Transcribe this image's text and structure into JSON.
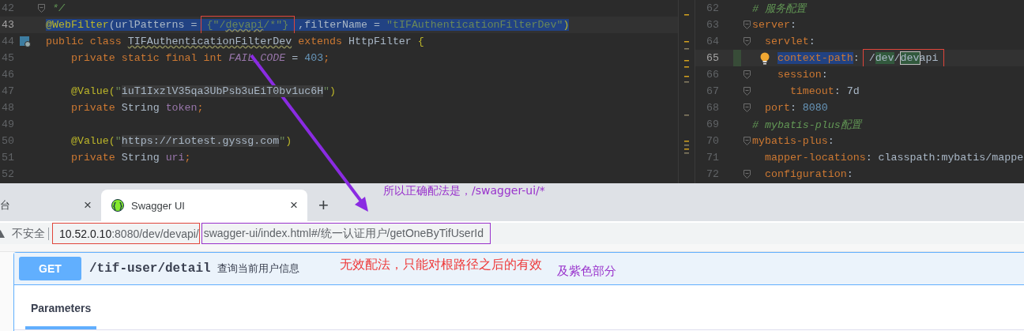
{
  "code_editor": {
    "lines": [
      {
        "number": "42",
        "fold": true,
        "current": false,
        "selected": false,
        "tokens": [
          {
            "text": " */",
            "kind": "doc"
          }
        ]
      },
      {
        "number": "43",
        "fold": false,
        "current": true,
        "selected": true,
        "tokens": [
          {
            "text": "@WebFilter",
            "kind": "annotation"
          },
          {
            "text": "(urlPatterns = ",
            "kind": "plain"
          },
          {
            "kind": "boxed",
            "parts": [
              {
                "text": "{\"/",
                "kind": "string"
              },
              {
                "text": "devapi",
                "kind": "string",
                "squiggle": true
              },
              {
                "text": "/*\"}",
                "kind": "string"
              }
            ]
          },
          {
            "text": " ,filterName = ",
            "kind": "plain"
          },
          {
            "text": "\"tIFAuthenticationFilterDev\"",
            "kind": "string"
          },
          {
            "text": ")",
            "kind": "annotation"
          }
        ]
      },
      {
        "number": "44",
        "fold": false,
        "current": false,
        "selected": false,
        "kind": "declaration",
        "tokens": [
          {
            "text": "public class ",
            "kind": "keyword"
          },
          {
            "text": "TIFAuthenticationFilterDev",
            "kind": "plain",
            "squiggle": true
          },
          {
            "text": " extends ",
            "kind": "keyword"
          },
          {
            "text": "HttpFilter ",
            "kind": "plain"
          },
          {
            "text": "{",
            "kind": "annotation"
          }
        ]
      },
      {
        "number": "45",
        "fold": false,
        "current": false,
        "selected": false,
        "tokens": [
          {
            "text": "    private static final int ",
            "kind": "keyword"
          },
          {
            "text": "FAIL_CODE",
            "kind": "constant"
          },
          {
            "text": " = ",
            "kind": "plain"
          },
          {
            "text": "403",
            "kind": "number"
          },
          {
            "text": ";",
            "kind": "keyword"
          }
        ]
      },
      {
        "number": "46",
        "fold": false,
        "current": false,
        "selected": false
      },
      {
        "number": "47",
        "fold": false,
        "current": false,
        "selected": false,
        "tokens": [
          {
            "text": "    @Value(",
            "kind": "annotation"
          },
          {
            "text": "\"",
            "kind": "string"
          },
          {
            "text": "iuT1IxzlV35qa3UbPsb3uEiT0bv1uc6H",
            "kind": "plain",
            "literal": true
          },
          {
            "text": "\"",
            "kind": "string"
          },
          {
            "text": ")",
            "kind": "annotation"
          }
        ]
      },
      {
        "number": "48",
        "fold": false,
        "current": false,
        "selected": false,
        "tokens": [
          {
            "text": "    private ",
            "kind": "keyword"
          },
          {
            "text": "String ",
            "kind": "plain"
          },
          {
            "text": "token",
            "kind": "field"
          },
          {
            "text": ";",
            "kind": "keyword"
          }
        ]
      },
      {
        "number": "49",
        "fold": false,
        "current": false,
        "selected": false
      },
      {
        "number": "50",
        "fold": false,
        "current": false,
        "selected": false,
        "tokens": [
          {
            "text": "    @Value(",
            "kind": "annotation"
          },
          {
            "text": "\"",
            "kind": "string"
          },
          {
            "text": "https://riotest.gyssg.com",
            "kind": "plain",
            "literal": true
          },
          {
            "text": "\"",
            "kind": "string"
          },
          {
            "text": ")",
            "kind": "annotation"
          }
        ]
      },
      {
        "number": "51",
        "fold": false,
        "current": false,
        "selected": false,
        "tokens": [
          {
            "text": "    private ",
            "kind": "keyword"
          },
          {
            "text": "String ",
            "kind": "plain"
          },
          {
            "text": "uri",
            "kind": "field"
          },
          {
            "text": ";",
            "kind": "keyword"
          }
        ]
      },
      {
        "number": "52",
        "fold": false,
        "current": false,
        "selected": false
      }
    ]
  },
  "config_editor": {
    "lines": [
      {
        "number": "62",
        "fold": false,
        "current": false,
        "changed": false,
        "tokens": [
          {
            "text": "# 服务配置",
            "kind": "comment"
          }
        ]
      },
      {
        "number": "63",
        "fold": true,
        "current": false,
        "changed": false,
        "tokens": [
          {
            "text": "server",
            "kind": "keyword"
          },
          {
            "text": ":",
            "kind": "plain"
          }
        ]
      },
      {
        "number": "64",
        "fold": true,
        "current": false,
        "changed": false,
        "tokens": [
          {
            "text": "  servlet",
            "kind": "keyword"
          },
          {
            "text": ":",
            "kind": "plain"
          }
        ]
      },
      {
        "number": "65",
        "fold": false,
        "current": true,
        "changed": true,
        "kind": "intention",
        "tokens": [
          {
            "text": "    context-path",
            "kind": "keyword",
            "selected": true
          },
          {
            "text": ": ",
            "kind": "plain"
          },
          {
            "kind": "boxed",
            "parts": [
              {
                "text": "/",
                "kind": "plain"
              },
              {
                "text": "dev",
                "kind": "plain",
                "match": true
              },
              {
                "text": "/",
                "kind": "plain"
              },
              {
                "text": "dev",
                "kind": "plain",
                "current_match": true
              },
              {
                "text": "api",
                "kind": "plain"
              }
            ]
          }
        ]
      },
      {
        "number": "66",
        "fold": true,
        "current": false,
        "changed": false,
        "tokens": [
          {
            "text": "    session",
            "kind": "keyword"
          },
          {
            "text": ":",
            "kind": "plain"
          }
        ]
      },
      {
        "number": "67",
        "fold": true,
        "current": false,
        "changed": false,
        "tokens": [
          {
            "text": "      timeout",
            "kind": "keyword"
          },
          {
            "text": ": ",
            "kind": "plain"
          },
          {
            "text": "7d",
            "kind": "plain"
          }
        ]
      },
      {
        "number": "68",
        "fold": true,
        "current": false,
        "changed": false,
        "tokens": [
          {
            "text": "  port",
            "kind": "keyword"
          },
          {
            "text": ": ",
            "kind": "plain"
          },
          {
            "text": "8080",
            "kind": "number"
          }
        ]
      },
      {
        "number": "69",
        "fold": false,
        "current": false,
        "changed": false,
        "tokens": [
          {
            "text": "# mybatis-plus配置",
            "kind": "comment"
          }
        ]
      },
      {
        "number": "70",
        "fold": true,
        "current": false,
        "changed": false,
        "tokens": [
          {
            "text": "mybatis-plus",
            "kind": "keyword"
          },
          {
            "text": ":",
            "kind": "plain"
          }
        ]
      },
      {
        "number": "71",
        "fold": false,
        "current": false,
        "changed": false,
        "tokens": [
          {
            "text": "  mapper-locations",
            "kind": "keyword"
          },
          {
            "text": ": ",
            "kind": "plain"
          },
          {
            "text": "classpath:mybatis/mappe",
            "kind": "plain"
          }
        ]
      },
      {
        "number": "72",
        "fold": true,
        "current": false,
        "changed": false,
        "tokens": [
          {
            "text": "  configuration",
            "kind": "keyword"
          },
          {
            "text": ":",
            "kind": "plain"
          }
        ]
      }
    ]
  },
  "browser": {
    "tabs": [
      {
        "title": "台",
        "close": "×",
        "selected": false,
        "icon": false
      },
      {
        "title": "Swagger UI",
        "close": "×",
        "selected": true,
        "icon": true
      }
    ],
    "new_tab": "+",
    "address_bar": {
      "security_label": "不安全",
      "url_groups": [
        {
          "kind": "base",
          "parts": [
            {
              "text": "10.52.0.10",
              "kind": "host"
            },
            {
              "text": ":8080/dev/devapi/",
              "kind": "path"
            }
          ]
        },
        {
          "kind": "route",
          "parts": [
            {
              "text": "swagger-ui/index.html#/统一认证用户/getOneByTifUserId",
              "kind": "path"
            }
          ]
        }
      ]
    }
  },
  "swagger": {
    "operation": {
      "method": "GET",
      "path": "/tif-user/detail",
      "summary": "查询当前用户信息"
    },
    "tabs": [
      {
        "label": "Parameters",
        "selected": true
      }
    ]
  },
  "annotations": [
    {
      "text": "所以正确配法是，/swagger-ui/*",
      "color": "#9932cc"
    },
    {
      "text": "无效配法，只能对根路径之后的有效",
      "color": "#ee3b3b"
    },
    {
      "text": "及紫色部分",
      "color": "#9932cc"
    }
  ]
}
